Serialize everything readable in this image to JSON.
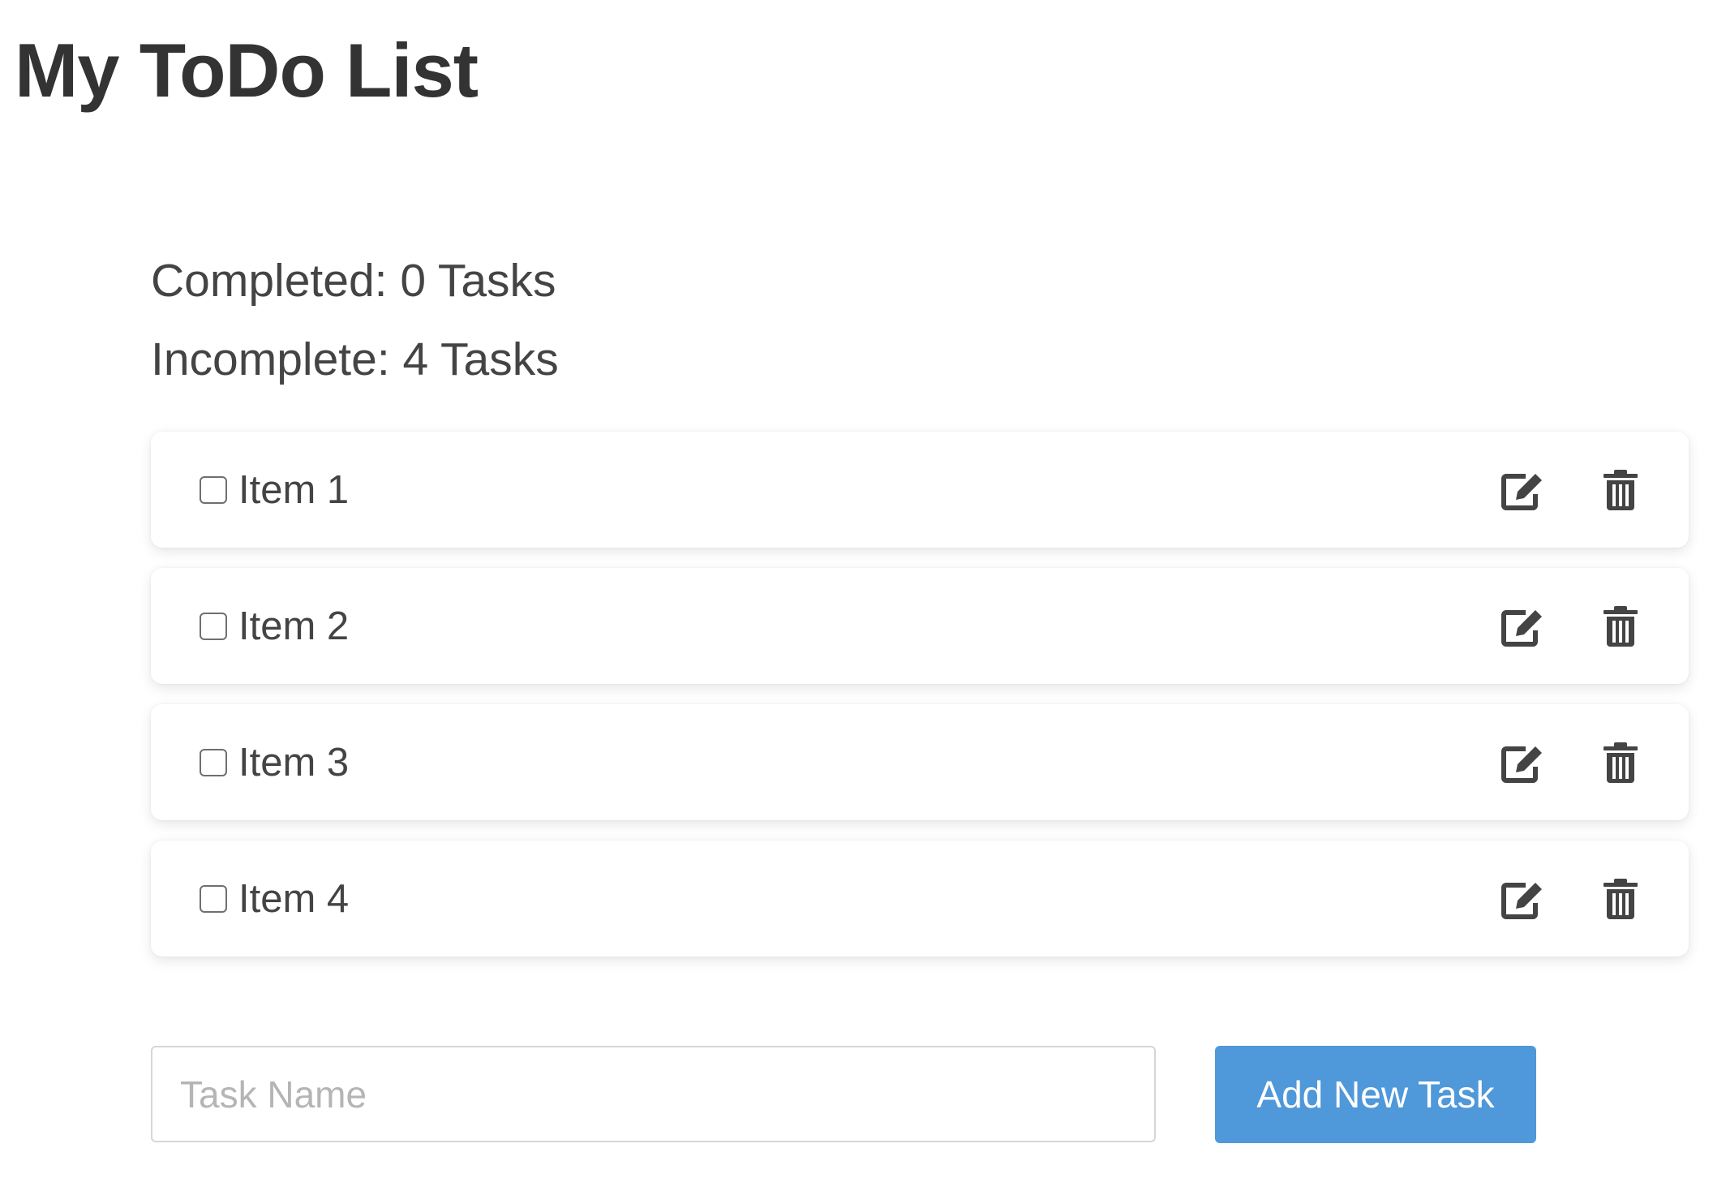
{
  "header": {
    "title": "My ToDo List"
  },
  "stats": {
    "completed_label": "Completed: 0 Tasks",
    "incomplete_label": "Incomplete: 4 Tasks"
  },
  "todos": [
    {
      "label": "Item 1",
      "checked": false,
      "edit_icon": "edit-icon",
      "delete_icon": "trash-icon"
    },
    {
      "label": "Item 2",
      "checked": false,
      "edit_icon": "edit-icon",
      "delete_icon": "trash-icon"
    },
    {
      "label": "Item 3",
      "checked": false,
      "edit_icon": "edit-icon",
      "delete_icon": "trash-icon"
    },
    {
      "label": "Item 4",
      "checked": false,
      "edit_icon": "edit-icon",
      "delete_icon": "trash-icon"
    }
  ],
  "new_task": {
    "placeholder": "Task Name",
    "value": "",
    "button_label": "Add New Task"
  },
  "colors": {
    "accent": "#4f98d9",
    "text": "#444444",
    "icon": "#444444"
  }
}
